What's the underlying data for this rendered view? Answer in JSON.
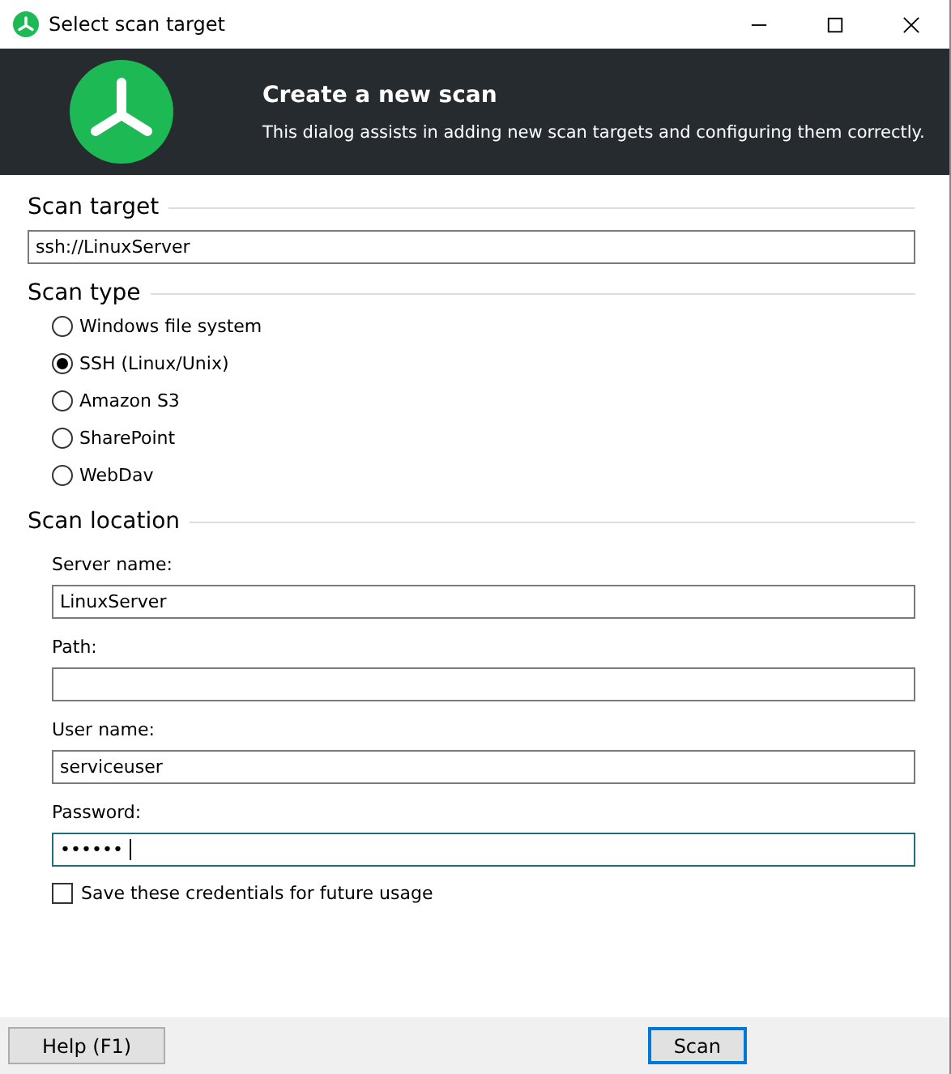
{
  "window": {
    "title": "Select scan target"
  },
  "header": {
    "title": "Create a new scan",
    "description": "This dialog assists in adding new scan targets and configuring them correctly."
  },
  "scan_target": {
    "heading": "Scan target",
    "value": "ssh://LinuxServer"
  },
  "scan_type": {
    "heading": "Scan type",
    "options": [
      {
        "label": "Windows file system",
        "selected": false
      },
      {
        "label": "SSH (Linux/Unix)",
        "selected": true
      },
      {
        "label": "Amazon S3",
        "selected": false
      },
      {
        "label": "SharePoint",
        "selected": false
      },
      {
        "label": "WebDav",
        "selected": false
      }
    ]
  },
  "scan_location": {
    "heading": "Scan location",
    "fields": [
      {
        "label": "Server name:",
        "value": "LinuxServer",
        "focused": false
      },
      {
        "label": "Path:",
        "focused": false
      },
      {
        "label": "User name:",
        "value": "serviceuser",
        "focused": false
      },
      {
        "label": "Password:",
        "value": "••••••",
        "focused": true
      }
    ],
    "save_credentials": {
      "label": "Save these credentials for future usage",
      "checked": false
    }
  },
  "buttons": {
    "help": "Help (F1)",
    "scan": "Scan"
  }
}
